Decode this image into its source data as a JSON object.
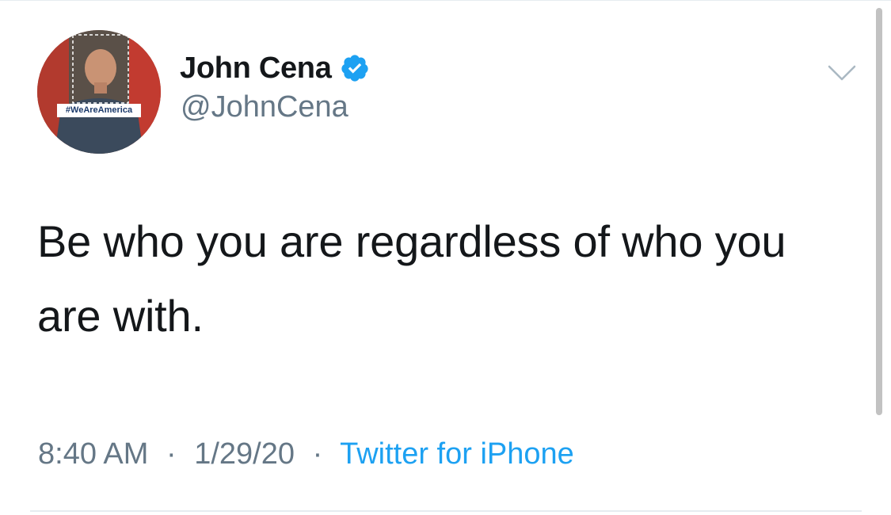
{
  "author": {
    "display_name": "John Cena",
    "handle": "@JohnCena",
    "verified": true,
    "avatar_tag": "#WeAreAmerica"
  },
  "tweet": {
    "text": "Be who you are regardless of who you are with.",
    "time": "8:40 AM",
    "date": "1/29/20",
    "separator": "·",
    "source": "Twitter for iPhone"
  },
  "colors": {
    "verified_badge": "#1da1f2",
    "link": "#1da1f2",
    "secondary_text": "#657786",
    "primary_text": "#14171a"
  },
  "icons": {
    "verified": "verified-badge-icon",
    "menu": "chevron-down-icon"
  }
}
